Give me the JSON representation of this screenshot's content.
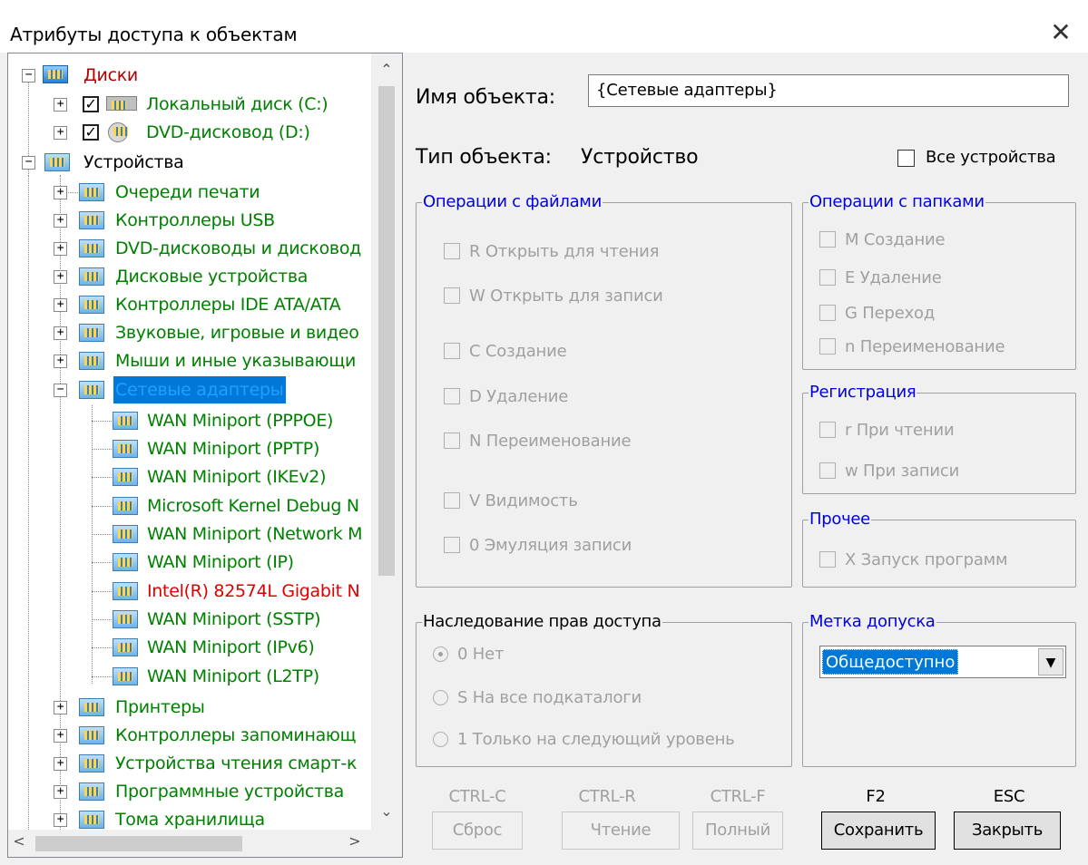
{
  "window": {
    "title": "Атрибуты доступа к объектам",
    "close_glyph": "✕"
  },
  "tree": {
    "disks": "Диски",
    "local_disk": "Локальный диск (C:)",
    "dvd_drive": "DVD-дисковод (D:)",
    "devices": "Устройства",
    "device_groups": [
      "Очереди печати",
      "Контроллеры USB",
      "DVD-дисководы и дисковод",
      "Дисковые устройства",
      "Контроллеры IDE ATA/ATA",
      "Звуковые, игровые и видео",
      "Мыши и иные указывающи",
      "Сетевые адаптеры"
    ],
    "adapters": [
      "WAN Miniport (PPPOE)",
      "WAN Miniport (PPTP)",
      "WAN Miniport (IKEv2)",
      "Microsoft Kernel Debug N",
      "WAN Miniport (Network M",
      "WAN Miniport (IP)",
      "Intel(R) 82574L Gigabit N",
      "WAN Miniport (SSTP)",
      "WAN Miniport (IPv6)",
      "WAN Miniport (L2TP)"
    ],
    "more_groups": [
      "Принтеры",
      "Контроллеры запоминающ",
      "Устройства чтения смарт-к",
      "Программные устройства",
      "Тома хранилища"
    ]
  },
  "object": {
    "name_label": "Имя объекта:",
    "name_value": "{Сетевые адаптеры}",
    "type_label": "Тип объекта:",
    "type_value": "Устройство",
    "all_devices": "Все устройства"
  },
  "file_ops": {
    "title": "Операции с файлами",
    "items": [
      "R Открыть для чтения",
      "W Открыть для записи",
      "C Создание",
      "D Удаление",
      "N Переименование",
      "V Видимость",
      "0 Эмуляция записи"
    ]
  },
  "folder_ops": {
    "title": "Операции с папками",
    "items": [
      "M Создание",
      "E Удаление",
      "G Переход",
      "n Переименование"
    ]
  },
  "registration": {
    "title": "Регистрация",
    "items": [
      "r При чтении",
      "w При записи"
    ]
  },
  "other": {
    "title": "Прочее",
    "items": [
      "X Запуск программ"
    ]
  },
  "inheritance": {
    "title": "Наследование прав доступа",
    "options": [
      "0 Нет",
      "S На все подкаталоги",
      "1 Только на следующий уровень"
    ],
    "selected": "0 Нет"
  },
  "access_label": {
    "title": "Метка допуска",
    "value": "Общедоступно"
  },
  "buttons": [
    {
      "hotkey": "CTRL-C",
      "label": "Сброс"
    },
    {
      "hotkey": "CTRL-R",
      "label": "Чтение"
    },
    {
      "hotkey": "CTRL-F",
      "label": "Полный"
    },
    {
      "hotkey": "F2",
      "label": "Сохранить"
    },
    {
      "hotkey": "ESC",
      "label": "Закрыть"
    }
  ],
  "colors": {
    "accent": "#0078d7",
    "group_title": "#0000e0",
    "tree_green": "#008000",
    "tree_red": "#e00000"
  }
}
